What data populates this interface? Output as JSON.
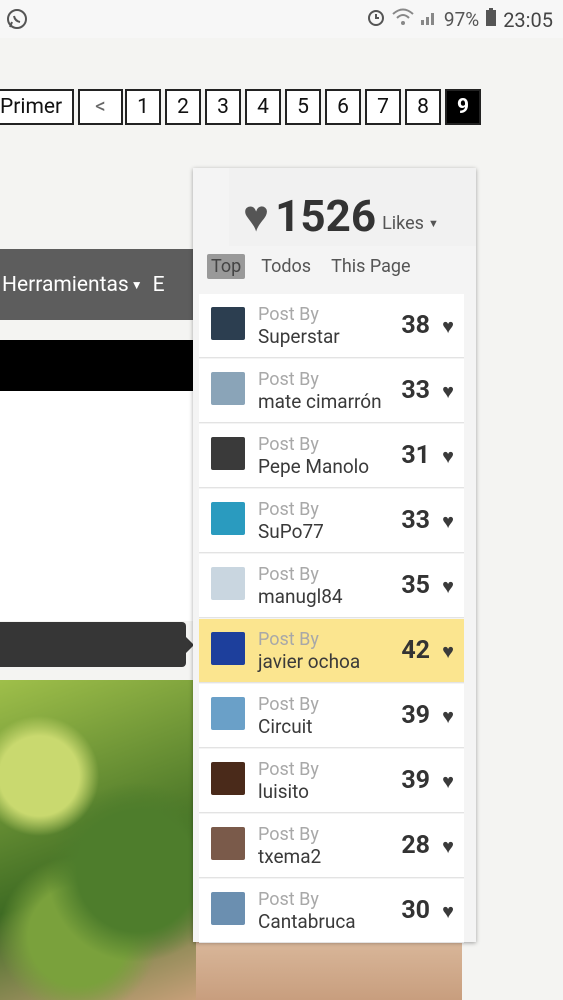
{
  "status_bar": {
    "battery": "97%",
    "time": "23:05"
  },
  "pagination": {
    "first_label": "Primer",
    "prev_label": "<",
    "pages": [
      "1",
      "2",
      "3",
      "4",
      "5",
      "6",
      "7",
      "8",
      "9"
    ],
    "active_page": "9"
  },
  "nav": {
    "item_label": "Herramientas",
    "next_label": "E"
  },
  "likes": {
    "count": "1526",
    "label": "Likes",
    "tabs": [
      "Top",
      "Todos",
      "This Page"
    ],
    "selected_tab": "Top",
    "post_by_label": "Post By",
    "entries": [
      {
        "name": "Superstar",
        "score": "38",
        "avatar_color": "#2c3e50"
      },
      {
        "name": "mate cimarrón",
        "score": "33",
        "avatar_color": "#8aa4b8"
      },
      {
        "name": "Pepe Manolo",
        "score": "31",
        "avatar_color": "#3a3a3a"
      },
      {
        "name": "SuPo77",
        "score": "33",
        "avatar_color": "#2a9bbf"
      },
      {
        "name": "manugl84",
        "score": "35",
        "avatar_color": "#c9d6e0"
      },
      {
        "name": "javier ochoa",
        "score": "42",
        "avatar_color": "#1d3f9c"
      },
      {
        "name": "Circuit",
        "score": "39",
        "avatar_color": "#6aa0c8"
      },
      {
        "name": "luisito",
        "score": "39",
        "avatar_color": "#4a2a1a"
      },
      {
        "name": "txema2",
        "score": "28",
        "avatar_color": "#7a5a4a"
      },
      {
        "name": "Cantabruca",
        "score": "30",
        "avatar_color": "#6b8fb0"
      }
    ],
    "highlighted_index": 5
  }
}
